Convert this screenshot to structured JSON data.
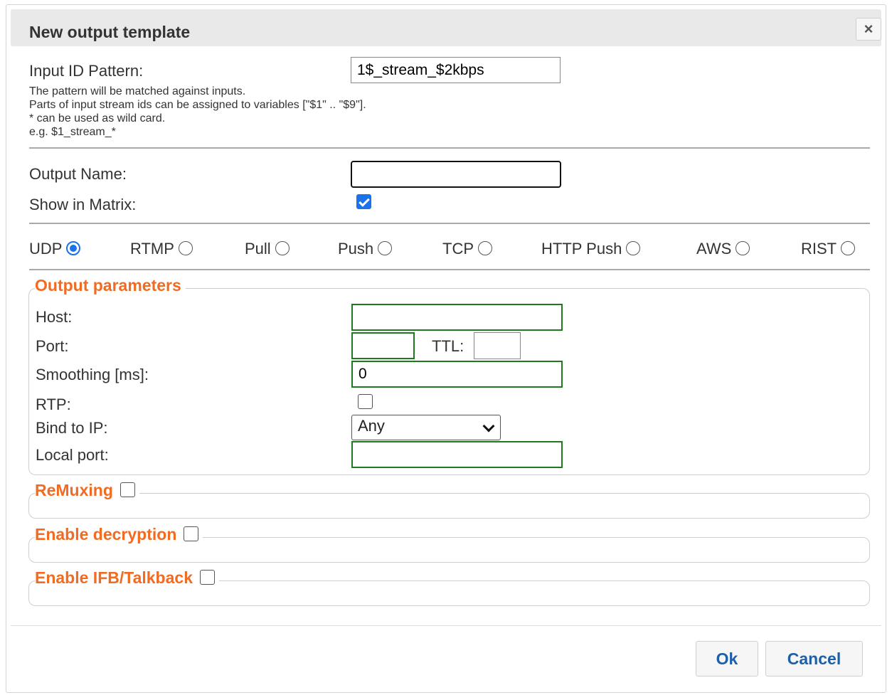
{
  "dialog": {
    "title": "New output template",
    "close_icon": "×"
  },
  "input_pattern": {
    "label": "Input ID Pattern:",
    "value": "1$_stream_$2kbps",
    "help": [
      "The pattern will be matched against inputs.",
      "Parts of input stream ids can be assigned to variables [\"$1\" .. \"$9\"].",
      "* can be used as wild card.",
      "e.g. $1_stream_*"
    ]
  },
  "output_name": {
    "label": "Output Name:",
    "value": ""
  },
  "show_in_matrix": {
    "label": "Show in Matrix:",
    "checked": true
  },
  "protocols": [
    {
      "label": "UDP",
      "checked": true
    },
    {
      "label": "RTMP",
      "checked": false
    },
    {
      "label": "Pull",
      "checked": false
    },
    {
      "label": "Push",
      "checked": false
    },
    {
      "label": "TCP",
      "checked": false
    },
    {
      "label": "HTTP Push",
      "checked": false
    },
    {
      "label": "AWS",
      "checked": false
    },
    {
      "label": "RIST",
      "checked": false
    }
  ],
  "output_params": {
    "legend": "Output parameters",
    "host_label": "Host:",
    "host_value": "",
    "port_label": "Port:",
    "port_value": "",
    "ttl_label": "TTL:",
    "ttl_value": "",
    "smoothing_label": "Smoothing [ms]:",
    "smoothing_value": "0",
    "rtp_label": "RTP:",
    "rtp_checked": false,
    "bind_label": "Bind to IP:",
    "bind_value": "Any",
    "local_port_label": "Local port:",
    "local_port_value": ""
  },
  "remuxing": {
    "legend": "ReMuxing",
    "checked": false
  },
  "decryption": {
    "legend": "Enable decryption",
    "checked": false
  },
  "ifb": {
    "legend": "Enable IFB/Talkback",
    "checked": false
  },
  "buttons": {
    "ok": "Ok",
    "cancel": "Cancel"
  },
  "colors": {
    "accent": "#f26b22",
    "link_blue": "#1d5fa8",
    "valid_green": "#1e7a1e",
    "check_blue": "#1a73e8"
  }
}
